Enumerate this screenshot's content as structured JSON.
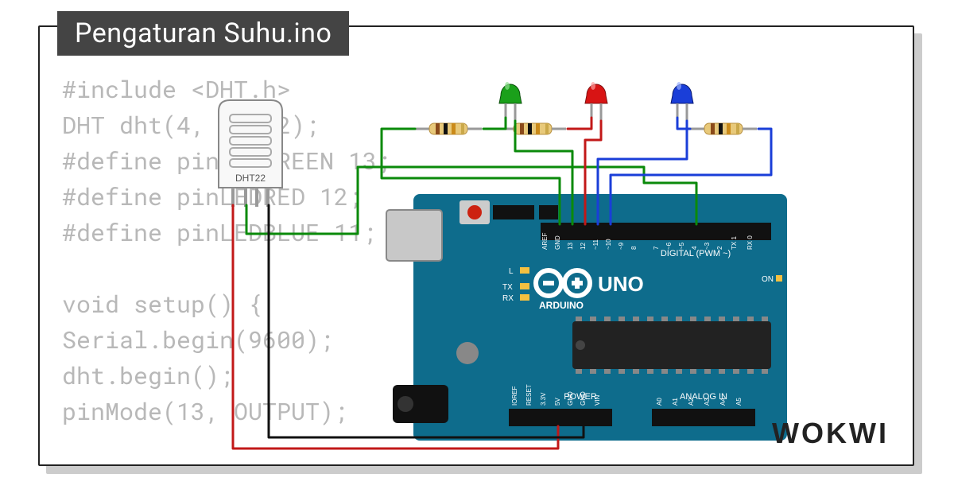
{
  "title": "Pengaturan Suhu.ino",
  "brand": "WOKWI",
  "code": "#include <DHT.h>\nDHT dht(4, DHT22);\n#define pinLEDGREEN 13;\n#define pinLEDRED 12;\n#define pinLEDBLUE 11;\n\nvoid setup() {\nSerial.begin(9600);\ndht.begin();\npinMode(13, OUTPUT);",
  "components": {
    "sensor": {
      "label": "DHT22"
    },
    "leds": [
      {
        "name": "green",
        "color": "#1aa01a"
      },
      {
        "name": "red",
        "color": "#d81414"
      },
      {
        "name": "blue",
        "color": "#1a3ed8"
      }
    ],
    "board": {
      "name": "ARDUINO",
      "model": "UNO",
      "labels": {
        "digital": "DIGITAL (PWM ~)",
        "analog": "ANALOG IN",
        "power": "POWER",
        "txrx": [
          "TX",
          "RX",
          "L"
        ],
        "on": "ON",
        "digital_pins": [
          "AREF",
          "GND",
          "13",
          "12",
          "~11",
          "~10",
          "~9",
          "8",
          "7",
          "~6",
          "~5",
          "4",
          "~3",
          "2",
          "TX 1",
          "RX 0"
        ],
        "power_pins": [
          "IOREF",
          "RESET",
          "3.3V",
          "5V",
          "GND",
          "GND",
          "VIN"
        ],
        "analog_pins": [
          "A0",
          "A1",
          "A2",
          "A3",
          "A4",
          "A5"
        ]
      }
    }
  },
  "wires": [
    {
      "color": "green",
      "from": "dht22-data",
      "to": "uno-d4"
    },
    {
      "color": "red",
      "from": "dht22-vcc",
      "to": "uno-5v"
    },
    {
      "color": "black",
      "from": "dht22-gnd",
      "to": "uno-gnd-power"
    },
    {
      "color": "green",
      "from": "led-green-anode",
      "to": "uno-d13"
    },
    {
      "color": "red",
      "from": "led-red-anode",
      "to": "uno-d12"
    },
    {
      "color": "blue",
      "from": "led-blue-anode",
      "to": "uno-d11"
    },
    {
      "color": "green",
      "from": "led-green-cathode",
      "to": "resistor-1"
    },
    {
      "color": "red",
      "from": "led-red-cathode",
      "to": "resistor-2"
    },
    {
      "color": "blue",
      "from": "led-blue-cathode",
      "to": "resistor-3"
    }
  ]
}
